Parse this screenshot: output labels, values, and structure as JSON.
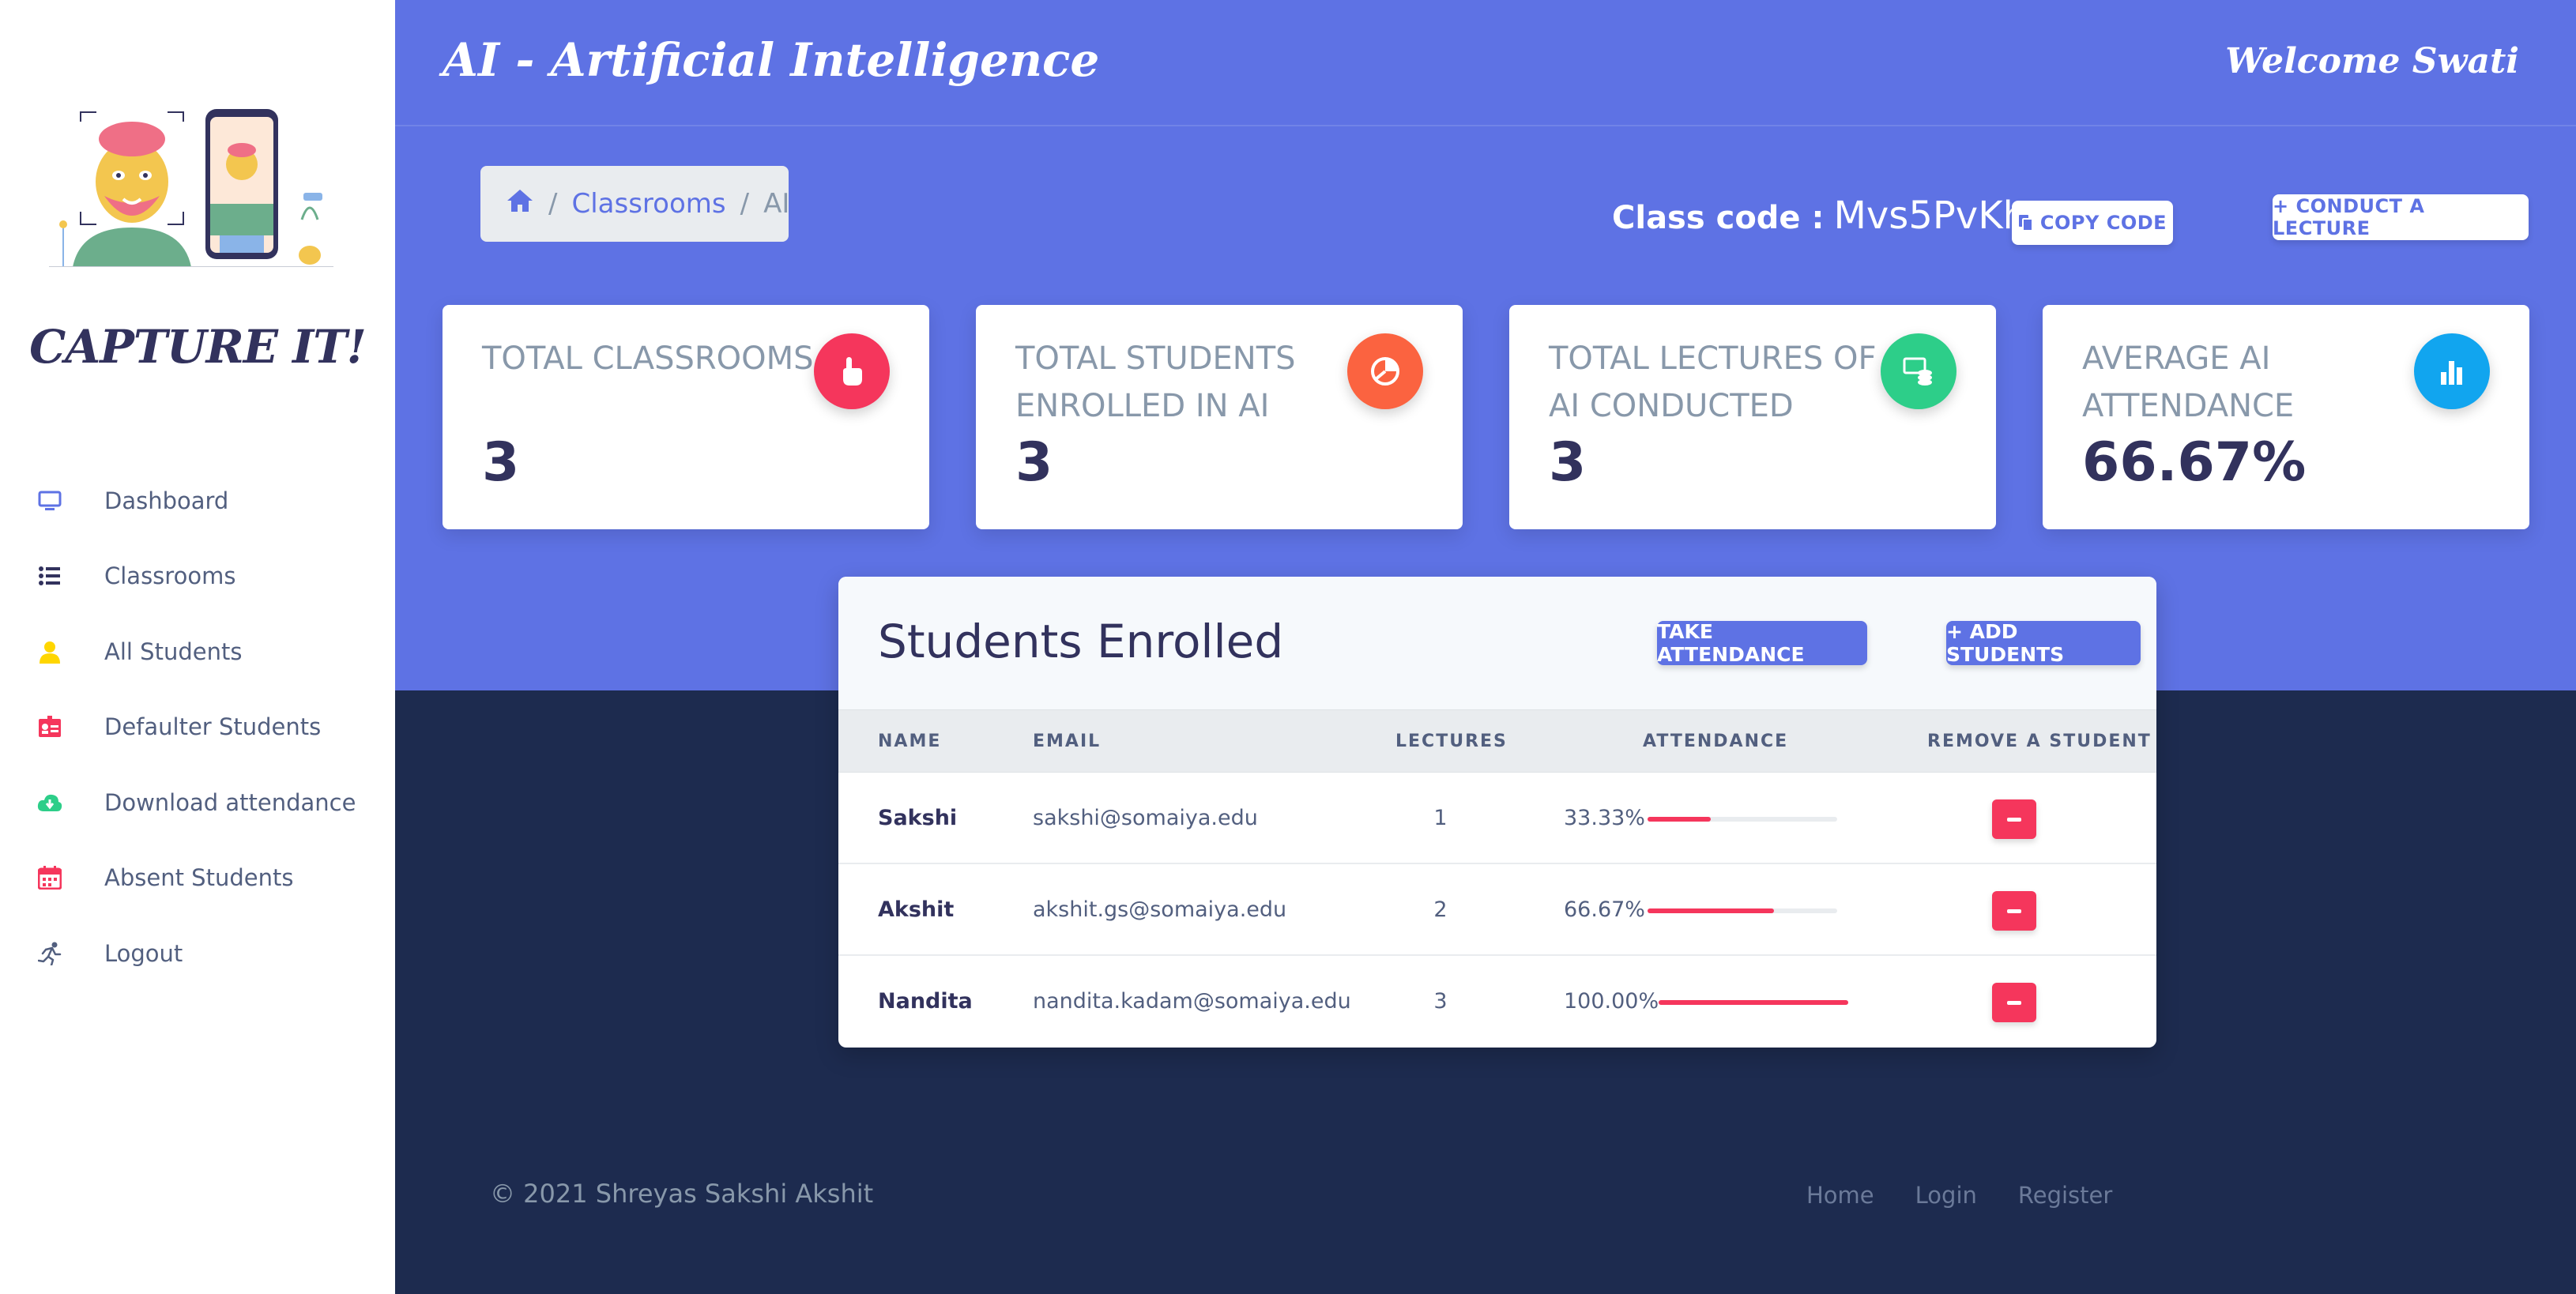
{
  "sidebar": {
    "brand": "CAPTURE IT!",
    "items": [
      {
        "label": "Dashboard",
        "icon": "monitor-icon",
        "color": "#5e72e4"
      },
      {
        "label": "Classrooms",
        "icon": "list-icon",
        "color": "#32325d"
      },
      {
        "label": "All Students",
        "icon": "user-icon",
        "color": "#ffd600"
      },
      {
        "label": "Defaulter Students",
        "icon": "id-card-icon",
        "color": "#f5365c"
      },
      {
        "label": "Download attendance",
        "icon": "cloud-download-icon",
        "color": "#2dce89"
      },
      {
        "label": "Absent Students",
        "icon": "calendar-icon",
        "color": "#f5365c"
      },
      {
        "label": "Logout",
        "icon": "running-icon",
        "color": "#525f7f"
      }
    ]
  },
  "header": {
    "title": "AI - Artificial Intelligence",
    "welcome": "Welcome Swati"
  },
  "breadcrumb": {
    "home_icon": "home-icon",
    "sep": "/",
    "link": "Classrooms",
    "current": "AI"
  },
  "classcode": {
    "label": "Class code :",
    "value": "Mvs5PvKh",
    "copy_label": "COPY CODE",
    "conduct_label": "+ CONDUCT A LECTURE"
  },
  "stats": [
    {
      "title": "TOTAL CLASSROOMS",
      "value": "3",
      "icon": "pointer-hand-icon",
      "color": "#f5365c"
    },
    {
      "title": "TOTAL STUDENTS ENROLLED IN AI",
      "value": "3",
      "icon": "pie-chart-icon",
      "color": "#fb6340"
    },
    {
      "title": "TOTAL LECTURES OF AI CONDUCTED",
      "value": "3",
      "icon": "money-coins-icon",
      "color": "#2dce89"
    },
    {
      "title": "AVERAGE AI ATTENDANCE",
      "value": "66.67%",
      "icon": "bar-chart-icon",
      "color": "#11cdef"
    }
  ],
  "students": {
    "title": "Students Enrolled",
    "take_attendance_label": "TAKE ATTENDANCE",
    "add_students_label": "+ ADD STUDENTS",
    "columns": [
      "NAME",
      "EMAIL",
      "LECTURES",
      "ATTENDANCE",
      "REMOVE A STUDENT"
    ],
    "rows": [
      {
        "name": "Sakshi",
        "email": "sakshi@somaiya.edu",
        "lectures": "1",
        "attendance": "33.33%",
        "pct": 0.3333
      },
      {
        "name": "Akshit",
        "email": "akshit.gs@somaiya.edu",
        "lectures": "2",
        "attendance": "66.67%",
        "pct": 0.6667
      },
      {
        "name": "Nandita",
        "email": "nandita.kadam@somaiya.edu",
        "lectures": "3",
        "attendance": "100.00%",
        "pct": 1.0
      }
    ]
  },
  "footer": {
    "copyright": "© 2021 Shreyas Sakshi Akshit",
    "links": [
      "Home",
      "Login",
      "Register"
    ]
  }
}
